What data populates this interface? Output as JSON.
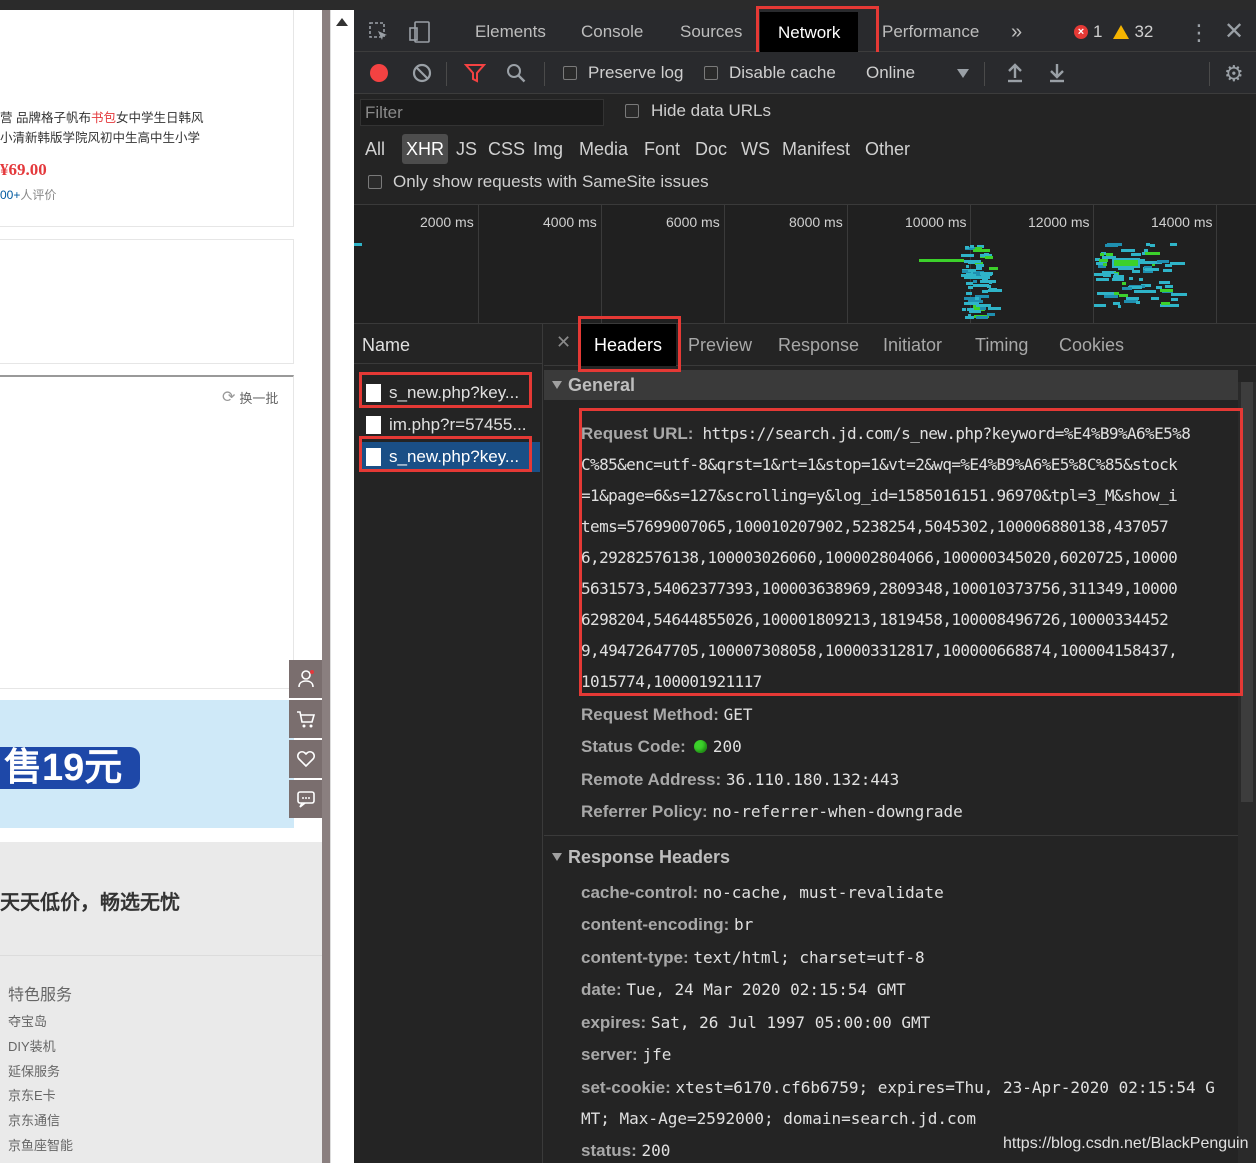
{
  "webpage": {
    "product_title_prefix": "营 品牌格子帆布",
    "product_title_highlight": "书包",
    "product_title_rest": "女中学生日韩风",
    "product_title_line2": "小清新韩版学院风初中生高中生小学",
    "price": "¥69.00",
    "reviews_count": "00+",
    "reviews_text": "人评价",
    "refresh_label": "换一批",
    "banner_text": "售19元",
    "slogan": "天天低价，畅选无忧",
    "services_title": "特色服务",
    "services": [
      "夺宝岛",
      "DIY装机",
      "延保服务",
      "京东E卡",
      "京东通信",
      "京鱼座智能"
    ]
  },
  "devtools": {
    "tabs": [
      "Elements",
      "Console",
      "Sources",
      "Network",
      "Performance"
    ],
    "active_tab": "Network",
    "more_tabs": "»",
    "error_count": "1",
    "warning_count": "32",
    "toolbar": {
      "preserve_log": "Preserve log",
      "disable_cache": "Disable cache",
      "throttle": "Online"
    },
    "filter_placeholder": "Filter",
    "hide_data_urls": "Hide data URLs",
    "type_filters": [
      "All",
      "XHR",
      "JS",
      "CSS",
      "Img",
      "Media",
      "Font",
      "Doc",
      "WS",
      "Manifest",
      "Other"
    ],
    "selected_type": "XHR",
    "samesite_only": "Only show requests with SameSite issues",
    "timeline_ticks": [
      "2000 ms",
      "4000 ms",
      "6000 ms",
      "8000 ms",
      "10000 ms",
      "12000 ms",
      "14000 ms"
    ],
    "name_header": "Name",
    "requests": [
      "s_new.php?key...",
      "im.php?r=57455...",
      "s_new.php?key..."
    ],
    "detail_tabs": [
      "Headers",
      "Preview",
      "Response",
      "Initiator",
      "Timing",
      "Cookies"
    ],
    "active_detail_tab": "Headers",
    "general": {
      "title": "General",
      "request_url_label": "Request URL:",
      "request_url_lines": [
        "https://search.jd.com/s_new.php?keyword=%E4%B9%A6%E5%8",
        "C%85&enc=utf-8&qrst=1&rt=1&stop=1&vt=2&wq=%E4%B9%A6%E5%8C%85&stock",
        "=1&page=6&s=127&scrolling=y&log_id=1585016151.96970&tpl=3_M&show_i",
        "tems=57699007065,100010207902,5238254,5045302,100006880138,437057",
        "6,29282576138,100003026060,100002804066,100000345020,6020725,10000",
        "5631573,54062377393,100003638969,2809348,100010373756,311349,10000",
        "6298204,54644855026,100001809213,1819458,100008496726,10000334452",
        "9,49472647705,100007308058,100003312817,100000668874,100004158437,",
        "1015774,100001921117"
      ],
      "request_method_label": "Request Method:",
      "request_method": "GET",
      "status_code_label": "Status Code:",
      "status_code": "200",
      "remote_address_label": "Remote Address:",
      "remote_address": "36.110.180.132:443",
      "referrer_policy_label": "Referrer Policy:",
      "referrer_policy": "no-referrer-when-downgrade"
    },
    "response_headers": {
      "title": "Response Headers",
      "items": [
        {
          "k": "cache-control:",
          "v": "no-cache, must-revalidate"
        },
        {
          "k": "content-encoding:",
          "v": "br"
        },
        {
          "k": "content-type:",
          "v": "text/html; charset=utf-8"
        },
        {
          "k": "date:",
          "v": "Tue, 24 Mar 2020 02:15:54 GMT"
        },
        {
          "k": "expires:",
          "v": "Sat, 26 Jul 1997 05:00:00 GMT"
        },
        {
          "k": "server:",
          "v": "jfe"
        },
        {
          "k": "set-cookie:",
          "v": "xtest=6170.cf6b6759; expires=Thu, 23-Apr-2020 02:15:54 G"
        },
        {
          "k": "",
          "v": "MT; Max-Age=2592000; domain=search.jd.com"
        },
        {
          "k": "status:",
          "v": "200"
        }
      ]
    },
    "colors": {
      "highlight_box": "#e53935",
      "selected_row": "#1a4f86",
      "status_ok": "#3cd12b"
    }
  },
  "watermark": "https://blog.csdn.net/BlackPenguin"
}
